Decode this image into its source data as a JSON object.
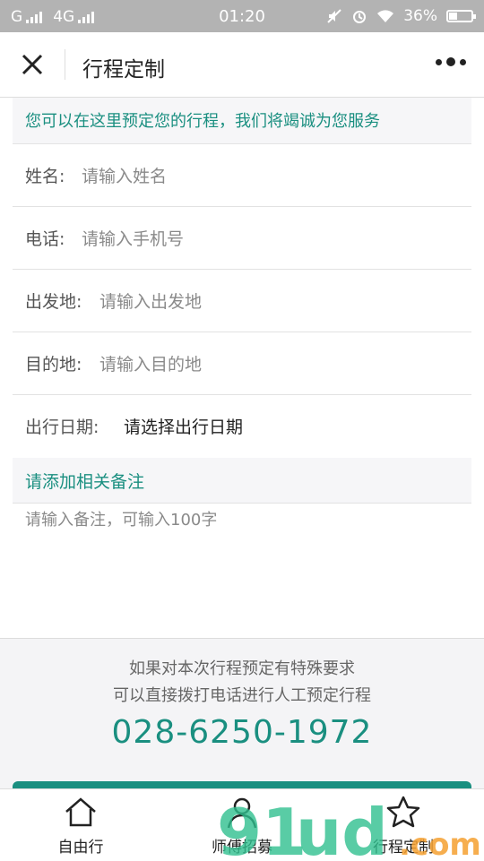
{
  "status_bar": {
    "carrier1": "G",
    "carrier2": "4G",
    "time": "01:20",
    "battery": "36%",
    "battery_level": 0.36
  },
  "title_bar": {
    "title": "行程定制",
    "close_icon": "close-icon",
    "more_icon": "more-icon"
  },
  "intro": "您可以在这里预定您的行程，我们将竭诚为您服务",
  "form": {
    "fields": [
      {
        "label": "姓名:",
        "placeholder": "请输入姓名"
      },
      {
        "label": "电话:",
        "placeholder": "请输入手机号"
      },
      {
        "label": "出发地:",
        "placeholder": "请输入出发地"
      },
      {
        "label": "目的地:",
        "placeholder": "请输入目的地"
      },
      {
        "label": "出行日期:",
        "placeholder": "请选择出行日期"
      }
    ],
    "notes_heading": "请添加相关备注",
    "notes_placeholder": "请输入备注，可输入100字"
  },
  "notice": {
    "line1": "如果对本次行程预定有特殊要求",
    "line2": "可以直接拨打电话进行人工预定行程",
    "phone": "028-6250-1972"
  },
  "tabbar": {
    "tabs": [
      {
        "label": "自由行",
        "icon": "home-icon"
      },
      {
        "label": "师傅招募",
        "icon": "person-icon"
      },
      {
        "label": "行程定制",
        "icon": "star-icon"
      }
    ]
  },
  "colors": {
    "accent": "#1a8f80",
    "status_bar": "#b3b3b3"
  }
}
